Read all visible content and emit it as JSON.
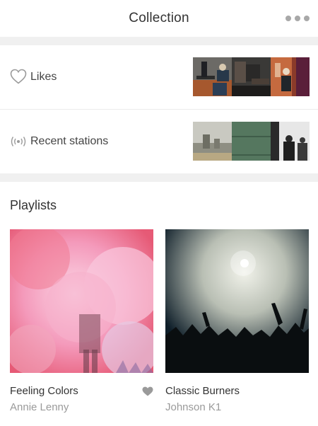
{
  "header": {
    "title": "Collection",
    "more_icon": "more-dots-icon"
  },
  "collection_rows": [
    {
      "label": "Likes",
      "icon": "heart-outline-icon"
    },
    {
      "label": "Recent stations",
      "icon": "radio-station-icon"
    }
  ],
  "playlists": {
    "section_title": "Playlists",
    "items": [
      {
        "title": "Feeling Colors",
        "artist": "Annie Lenny",
        "liked": true,
        "cover_colors": [
          "#f26d8b",
          "#f7b8d0"
        ]
      },
      {
        "title": "Classic Burners",
        "artist": "Johnson K1",
        "liked": false,
        "cover_colors": [
          "#0f1f2a",
          "#d8d9cf"
        ]
      }
    ]
  },
  "colors": {
    "primary_text": "#333333",
    "secondary_text": "#9a9a9a",
    "icon_gray": "#a8a8a8",
    "band_gray": "#f0f0f0"
  }
}
